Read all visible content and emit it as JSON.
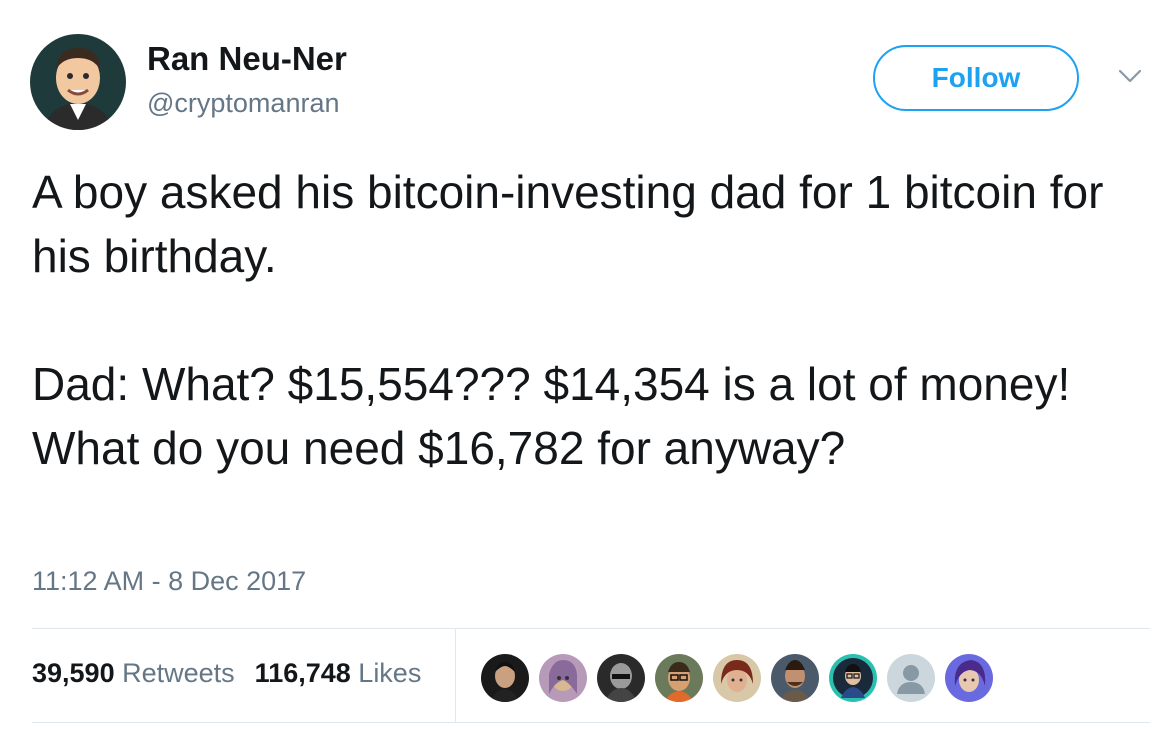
{
  "author": {
    "display_name": "Ran Neu-Ner",
    "handle": "@cryptomanran"
  },
  "follow_button": {
    "label": "Follow"
  },
  "tweet": {
    "paragraph1": "A boy asked his bitcoin-investing dad for 1 bitcoin for his birthday.",
    "paragraph2": "Dad: What? $15,554??? $14,354 is a lot of money! What do you need $16,782 for anyway?"
  },
  "timestamp": "11:12 AM - 8 Dec 2017",
  "stats": {
    "retweets_count": "39,590",
    "retweets_label": "Retweets",
    "likes_count": "116,748",
    "likes_label": "Likes"
  },
  "likers": [
    {
      "icon": "liker-avatar-1"
    },
    {
      "icon": "liker-avatar-2"
    },
    {
      "icon": "liker-avatar-3"
    },
    {
      "icon": "liker-avatar-4"
    },
    {
      "icon": "liker-avatar-5"
    },
    {
      "icon": "liker-avatar-6"
    },
    {
      "icon": "liker-avatar-7"
    },
    {
      "icon": "liker-avatar-default"
    },
    {
      "icon": "liker-avatar-9"
    }
  ],
  "colors": {
    "accent": "#1da1f2",
    "text": "#14171a",
    "secondary": "#657786",
    "divider": "#e1e8ed"
  }
}
